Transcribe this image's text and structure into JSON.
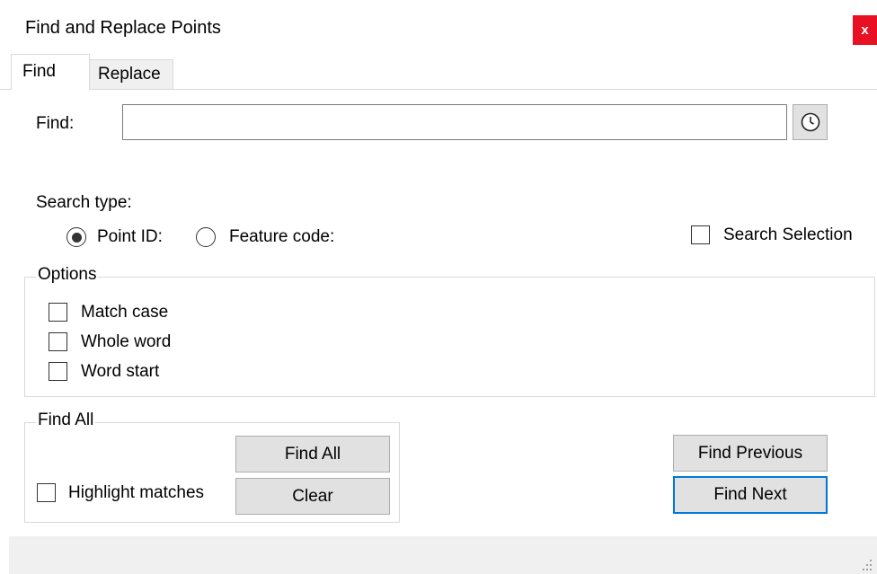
{
  "window": {
    "title": "Find and Replace Points",
    "close_label": "x"
  },
  "tabs": [
    {
      "label": "Find"
    },
    {
      "label": "Replace"
    }
  ],
  "find": {
    "label": "Find:",
    "value": "",
    "placeholder": ""
  },
  "search_type": {
    "label": "Search type:",
    "point_id_label": "Point ID:",
    "feature_code_label": "Feature code:",
    "selected": "Point ID:"
  },
  "search_selection_label": "Search Selection",
  "options": {
    "legend": "Options",
    "match_case": "Match case",
    "whole_word": "Whole word",
    "word_start": "Word start"
  },
  "find_all_group": {
    "legend": "Find All",
    "find_all_button": "Find All",
    "clear_button": "Clear",
    "highlight_label": "Highlight matches"
  },
  "buttons": {
    "find_previous": "Find Previous",
    "find_next": "Find Next"
  },
  "icons": {
    "history": "clock-icon",
    "close": "close-icon",
    "grip": "resize-grip-icon"
  },
  "colors": {
    "close_bg": "#e81123",
    "default_button_border": "#0078d7",
    "button_bg": "#e1e1e1"
  }
}
